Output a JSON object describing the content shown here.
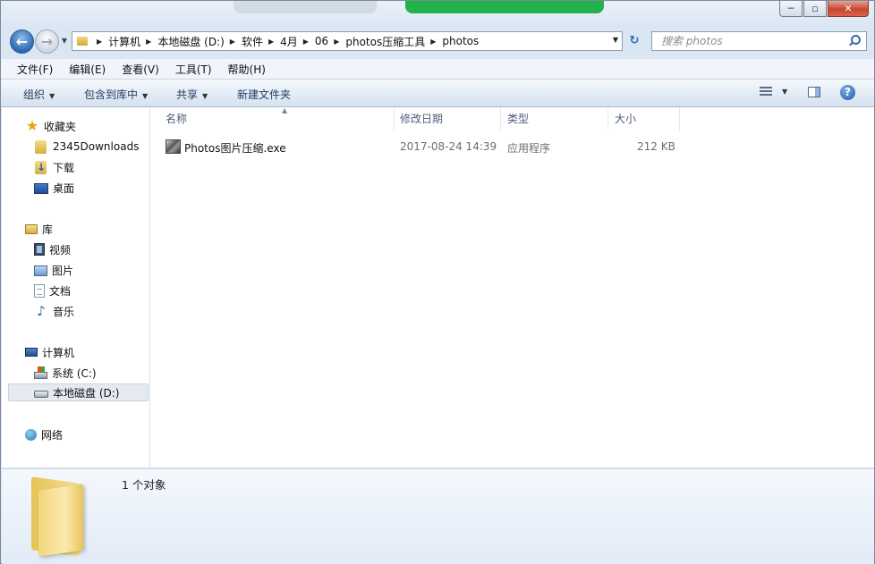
{
  "window": {
    "controls": {
      "minimize": "─",
      "maximize": "▫",
      "close": "✕"
    }
  },
  "nav": {
    "back_icon": "←",
    "forward_icon": "→",
    "history_icon": "▼",
    "breadcrumbs": [
      "计算机",
      "本地磁盘 (D:)",
      "软件",
      "4月",
      "06",
      "photos压缩工具",
      "photos"
    ],
    "address_dropdown_icon": "▼",
    "refresh_icon": "↻",
    "search_placeholder": "搜索 photos"
  },
  "menubar": [
    "文件(F)",
    "编辑(E)",
    "查看(V)",
    "工具(T)",
    "帮助(H)"
  ],
  "toolbar": {
    "organize": "组织",
    "include_in_library": "包含到库中",
    "share": "共享",
    "new_folder": "新建文件夹",
    "dropdown_arrow": "▼",
    "views_dropdown": "▼",
    "help": "?"
  },
  "sidebar": {
    "favorites_header": "收藏夹",
    "favorites": [
      "2345Downloads",
      "下载",
      "桌面"
    ],
    "libraries_header": "库",
    "libraries": [
      "视频",
      "图片",
      "文档",
      "音乐"
    ],
    "computer_header": "计算机",
    "drives": [
      "系统 (C:)",
      "本地磁盘 (D:)"
    ],
    "selected_drive": "本地磁盘 (D:)",
    "network_header": "网络"
  },
  "filelist": {
    "columns": [
      "名称",
      "修改日期",
      "类型",
      "大小"
    ],
    "sort_indicator": "▲",
    "rows": [
      {
        "name": "Photos图片压缩.exe",
        "modified": "2017-08-24 14:39",
        "type": "应用程序",
        "size": "212 KB"
      }
    ]
  },
  "details": {
    "item_count": "1 个对象"
  },
  "colors": {
    "chrome": "#dbe6f3",
    "accent": "#2d68b4",
    "close_button": "#c8452e",
    "title_glow_green": "#21b24a"
  },
  "icons": {
    "favorites": "star-icon",
    "folder": "folder-icon",
    "downloads": "downloads-folder-icon",
    "desktop": "desktop-icon",
    "library": "library-icon",
    "video": "video-library-icon",
    "pictures": "pictures-library-icon",
    "documents": "documents-library-icon",
    "music": "music-library-icon",
    "computer": "computer-icon",
    "drive_c": "system-drive-icon",
    "drive_d": "local-disk-icon",
    "network": "network-icon",
    "exe": "application-icon"
  }
}
